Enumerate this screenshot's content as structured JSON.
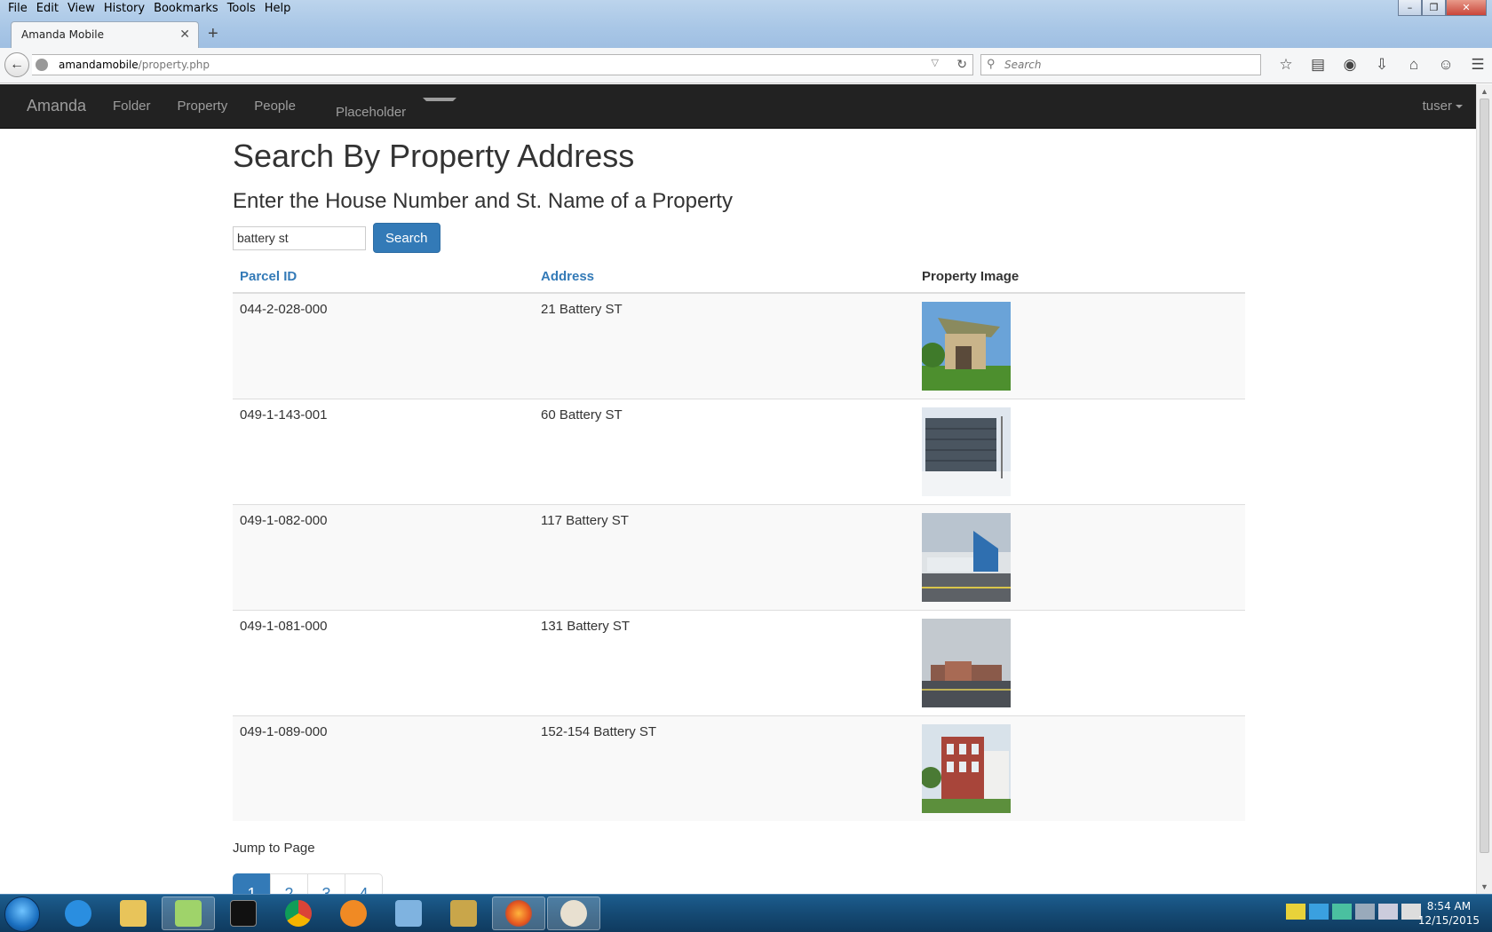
{
  "browser": {
    "menu": [
      "File",
      "Edit",
      "View",
      "History",
      "Bookmarks",
      "Tools",
      "Help"
    ],
    "tab_title": "Amanda Mobile",
    "url_host": "amandamobile",
    "url_path": "/property.php",
    "search_placeholder": "Search"
  },
  "app": {
    "brand": "Amanda",
    "nav": [
      "Folder",
      "Property",
      "People",
      "Placeholder"
    ],
    "user": "tuser"
  },
  "page": {
    "title": "Search By Property Address",
    "subtitle": "Enter the House Number and St. Name of a Property",
    "search_value": "battery st",
    "search_button": "Search"
  },
  "table": {
    "headers": {
      "parcel": "Parcel ID",
      "address": "Address",
      "image": "Property Image"
    },
    "rows": [
      {
        "parcel": "044-2-028-000",
        "address": "21 Battery ST"
      },
      {
        "parcel": "049-1-143-001",
        "address": "60 Battery ST"
      },
      {
        "parcel": "049-1-082-000",
        "address": "117 Battery ST"
      },
      {
        "parcel": "049-1-081-000",
        "address": "131 Battery ST"
      },
      {
        "parcel": "049-1-089-000",
        "address": "152-154 Battery ST"
      }
    ]
  },
  "pagination": {
    "label": "Jump to Page",
    "pages": [
      "1",
      "2",
      "3",
      "4"
    ],
    "active": "1"
  },
  "taskbar": {
    "time": "8:54 AM",
    "date": "12/15/2015"
  }
}
